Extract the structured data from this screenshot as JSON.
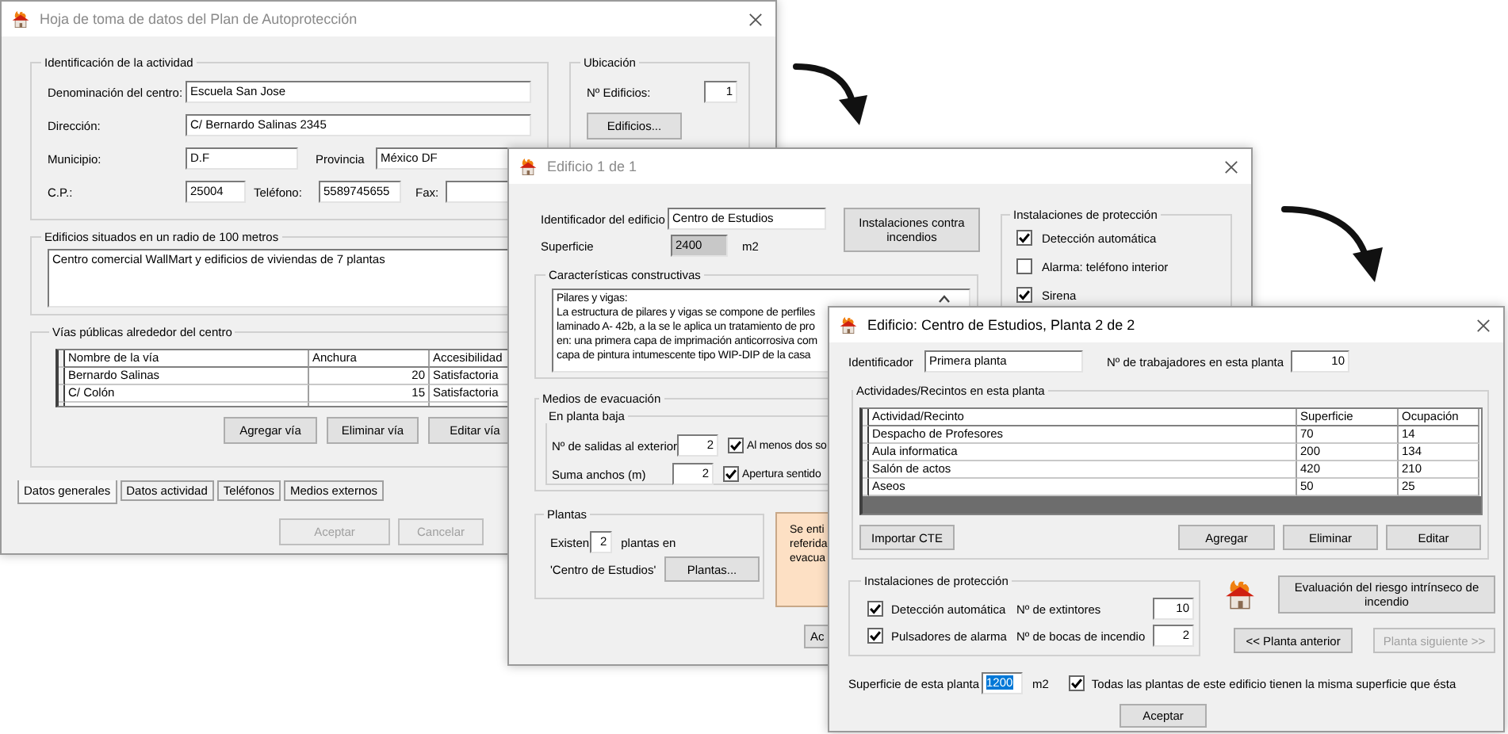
{
  "main_window": {
    "title": "Hoja de toma de datos del Plan de Autoprotección",
    "active": false,
    "activity": {
      "legend": "Identificación de la actividad",
      "name": {
        "label": "Denominación del centro:",
        "value": "Escuela San Jose"
      },
      "address": {
        "label": "Dirección:",
        "value": "C/ Bernardo Salinas 2345"
      },
      "municipality": {
        "label": "Municipio:",
        "value": "D.F"
      },
      "province": {
        "label": "Provincia",
        "value": "México DF"
      },
      "postcode": {
        "label": "C.P.:",
        "value": "25004"
      },
      "phone": {
        "label": "Teléfono:",
        "value": "5589745655"
      },
      "fax": {
        "label": "Fax:"
      }
    },
    "location": {
      "legend": "Ubicación",
      "buildings": {
        "label": "Nº Edificios:",
        "value": "1"
      },
      "button": "Edificios..."
    },
    "nearby": {
      "legend": "Edificios situados en un radio de 100 metros",
      "value": "Centro comercial WallMart y edificios de viviendas de 7 plantas"
    },
    "roads": {
      "legend": "Vías públicas alrededor del centro",
      "columns": [
        "Nombre de la vía",
        "Anchura",
        "Accesibilidad"
      ],
      "rows": [
        [
          "Bernardo Salinas",
          "20",
          "Satisfactoria"
        ],
        [
          "C/ Colón",
          "15",
          "Satisfactoria"
        ]
      ],
      "buttons": [
        "Agregar vía",
        "Eliminar vía",
        "Editar vía"
      ]
    },
    "tabs": [
      {
        "label": "Datos generales",
        "selected": true
      },
      {
        "label": "Datos actividad",
        "selected": false
      },
      {
        "label": "Teléfonos",
        "selected": false
      },
      {
        "label": "Medios externos",
        "selected": false
      }
    ],
    "buttons": [
      {
        "label": "Aceptar",
        "disabled": true
      },
      {
        "label": "Cancelar",
        "disabled": true
      }
    ]
  },
  "building_window": {
    "title": "Edificio 1 de 1",
    "active": false,
    "identifier": {
      "label": "Identificador del edificio",
      "value": "Centro de Estudios"
    },
    "surface": {
      "label": "Superficie",
      "value": "2400",
      "unit": "m2"
    },
    "fire_button": "Instalaciones contra incendios",
    "protection": {
      "legend": "Instalaciones de protección",
      "items": [
        {
          "label": "Detección automática",
          "checked": true
        },
        {
          "label": "Alarma: teléfono interior",
          "checked": false
        },
        {
          "label": "Sirena",
          "checked": true
        }
      ]
    },
    "construction": {
      "legend": "Características constructivas",
      "text": "Pilares y vigas:\nLa estructura de pilares y vigas se compone de perfiles\nlaminado A- 42b, a la se le aplica un tratamiento de pro\nen: una primera capa de imprimación anticorrosiva com\ncapa de pintura intumescente tipo WIP-DIP de la casa"
    },
    "evacuation": {
      "legend": "Medios de evacuación",
      "sublegend": "En planta baja",
      "rows": [
        {
          "label": "Nº de salidas al exterior",
          "value": "2",
          "check_label": "Al menos dos so",
          "checked": true
        },
        {
          "label": "Suma anchos (m)",
          "value": "2",
          "check_label": "Apertura sentido",
          "checked": true
        }
      ]
    },
    "floors": {
      "legend": "Plantas",
      "prefix": "Existen",
      "value": "2",
      "suffix": "plantas en",
      "building": "'Centro de Estudios'",
      "button": "Plantas..."
    },
    "note": "Se enti\nreferida\nevacua",
    "button": "Ac"
  },
  "floor_window": {
    "title": "Edificio: Centro de Estudios, Planta 2 de 2",
    "active": true,
    "identifier": {
      "label": "Identificador",
      "value": "Primera planta"
    },
    "workers": {
      "label": "Nº de trabajadores en esta planta",
      "value": "10"
    },
    "activities": {
      "legend": "Actividades/Recintos en esta planta",
      "columns": [
        "Actividad/Recinto",
        "Superficie",
        "Ocupación"
      ],
      "rows": [
        [
          "Despacho de Profesores",
          "70",
          "14"
        ],
        [
          "Aula informatica",
          "200",
          "134"
        ],
        [
          "Salón de actos",
          "420",
          "210"
        ],
        [
          "Aseos",
          "50",
          "25"
        ]
      ],
      "buttons": [
        "Importar CTE",
        "Agregar",
        "Eliminar",
        "Editar"
      ]
    },
    "protection": {
      "legend": "Instalaciones de protección",
      "items": [
        {
          "label": "Detección automática",
          "checked": true,
          "count_label": "Nº de extintores",
          "count": "10"
        },
        {
          "label": "Pulsadores de alarma",
          "checked": true,
          "count_label": "Nº de bocas de incendio",
          "count": "2"
        }
      ]
    },
    "risk_button": "Evaluación del riesgo intrínseco de incendio",
    "nav_buttons": [
      {
        "label": "<< Planta anterior",
        "disabled": false
      },
      {
        "label": "Planta siguiente >>",
        "disabled": true
      }
    ],
    "surface": {
      "label": "Superficie de esta planta",
      "value": "1200",
      "unit": "m2",
      "selected": true
    },
    "same_surface": {
      "label": "Todas las plantas de este edificio tienen la misma superficie que ésta",
      "checked": true
    },
    "button": "Aceptar"
  }
}
